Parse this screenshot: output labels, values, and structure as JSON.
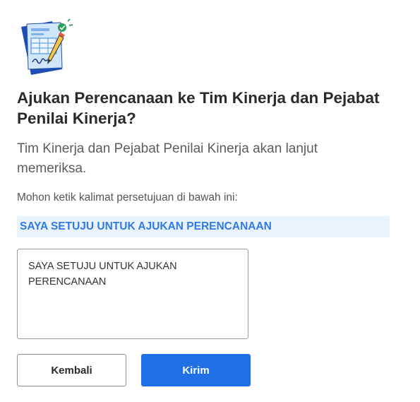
{
  "dialog": {
    "title": "Ajukan Perencanaan ke Tim Kinerja dan Pejabat Penilai Kinerja?",
    "subtitle": "Tim Kinerja dan Pejabat Penilai Kinerja akan lanjut memeriksa.",
    "instruction": "Mohon ketik kalimat persetujuan di bawah ini:",
    "confirmation_phrase": "SAYA SETUJU UNTUK AJUKAN PERENCANAAN",
    "input_value": "SAYA SETUJU UNTUK AJUKAN PERENCANAAN",
    "illustration_icon": "document-sign-icon",
    "buttons": {
      "back_label": "Kembali",
      "send_label": "Kirim"
    },
    "colors": {
      "accent": "#1f6fe6",
      "phrase_text": "#2f7ae5",
      "phrase_background": "#eaf2fb",
      "check_badge": "#2e9d55"
    }
  }
}
